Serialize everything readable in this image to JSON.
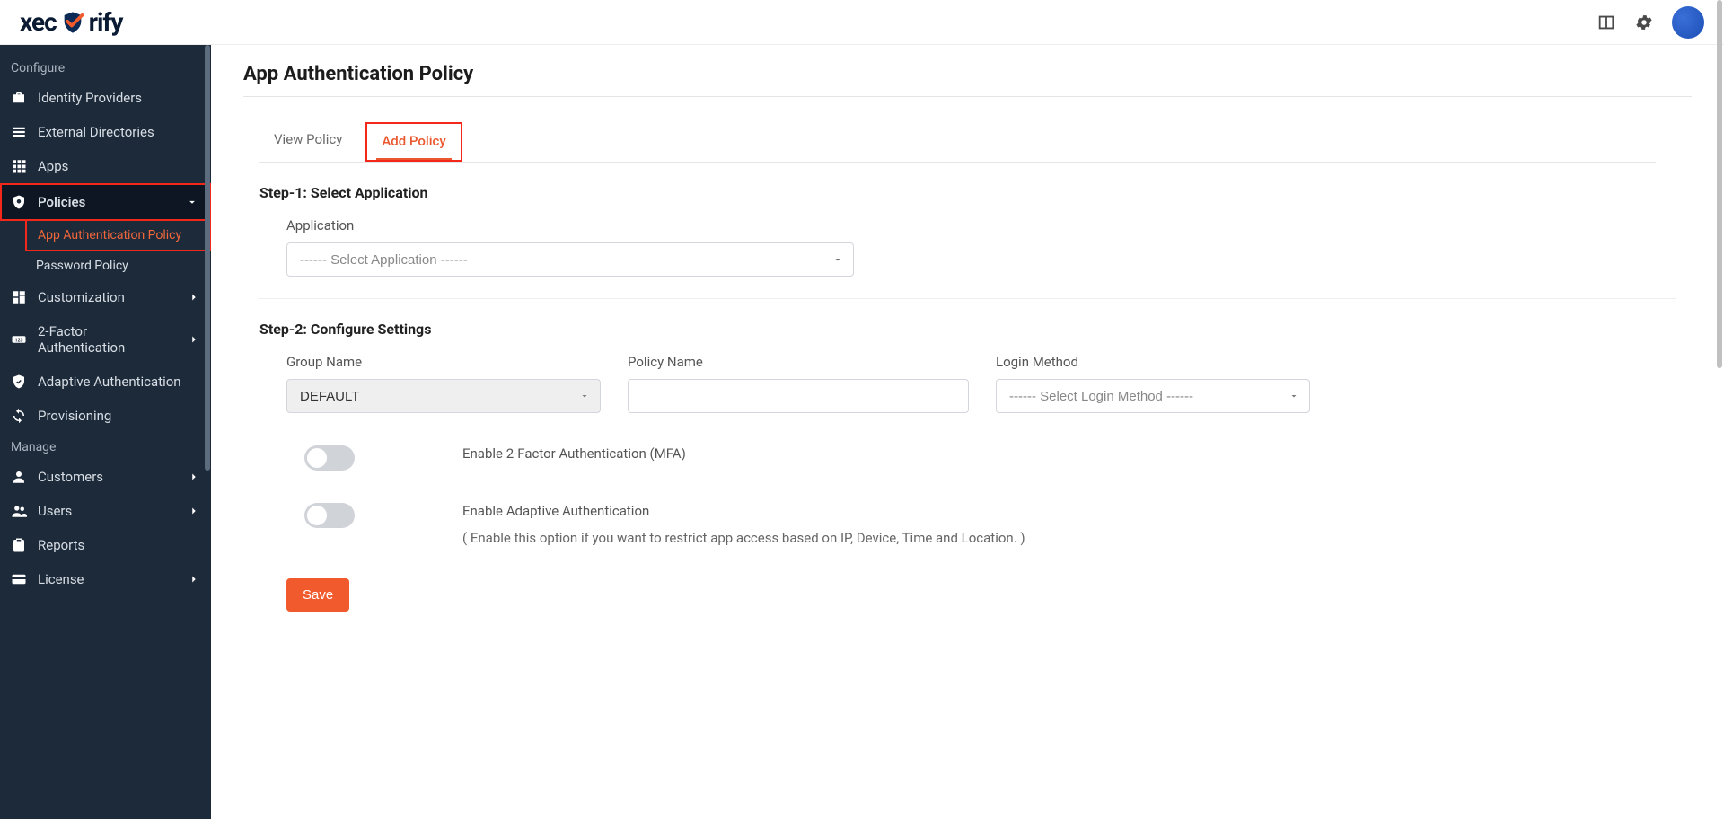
{
  "brand": {
    "part1": "xec",
    "part2": "rify"
  },
  "sidebar": {
    "section_configure": "Configure",
    "identity_providers": "Identity Providers",
    "external_directories": "External Directories",
    "apps": "Apps",
    "policies": "Policies",
    "policies_sub": {
      "app_auth_policy": "App Authentication Policy",
      "password_policy": "Password Policy"
    },
    "customization": "Customization",
    "two_factor": "2-Factor Authentication",
    "adaptive_auth": "Adaptive Authentication",
    "provisioning": "Provisioning",
    "section_manage": "Manage",
    "customers": "Customers",
    "users": "Users",
    "reports": "Reports",
    "license": "License"
  },
  "page": {
    "title": "App Authentication Policy",
    "tab_view": "View Policy",
    "tab_add": "Add Policy",
    "step1_title": "Step-1: Select Application",
    "application_label": "Application",
    "application_placeholder": "------ Select Application ------",
    "step2_title": "Step-2: Configure Settings",
    "group_name_label": "Group Name",
    "group_name_value": "DEFAULT",
    "policy_name_label": "Policy Name",
    "login_method_label": "Login Method",
    "login_method_placeholder": "------ Select Login Method ------",
    "toggle_2fa": "Enable 2-Factor Authentication (MFA)",
    "toggle_adaptive": "Enable Adaptive Authentication",
    "toggle_adaptive_hint": "( Enable this option if you want to restrict app access based on IP, Device, Time and Location. )",
    "save": "Save"
  }
}
